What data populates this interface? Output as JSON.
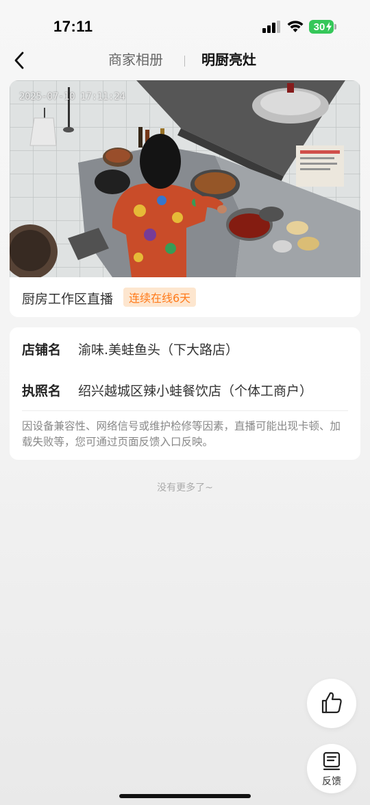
{
  "status_bar": {
    "time": "17:11",
    "battery": "30",
    "icons": [
      "signal-icon",
      "wifi-icon",
      "battery-icon"
    ]
  },
  "nav": {
    "back_icon": "chevron-left-icon",
    "tabs": [
      {
        "label": "商家相册",
        "active": false
      },
      {
        "label": "明厨亮灶",
        "active": true
      }
    ]
  },
  "live": {
    "timestamp": "2025-07-10 17:11:24",
    "caption": "厨房工作区直播",
    "badge": "连续在线6天"
  },
  "store": {
    "name_label": "店铺名",
    "name_value": "渝味.美蛙鱼头（下大路店）",
    "license_label": "执照名",
    "license_value": "绍兴越城区辣小蛙餐饮店（个体工商户）",
    "note": "因设备兼容性、网络信号或维护检修等因素，直播可能出现卡顿、加载失败等，您可通过页面反馈入口反映。"
  },
  "end_text": "没有更多了~",
  "floating": {
    "like_icon": "thumbs-up-icon",
    "feedback_icon": "feedback-icon",
    "feedback_label": "反馈"
  },
  "colors": {
    "badge_bg": "#fde6cf",
    "badge_text": "#ff7a1a",
    "battery": "#35c759"
  }
}
